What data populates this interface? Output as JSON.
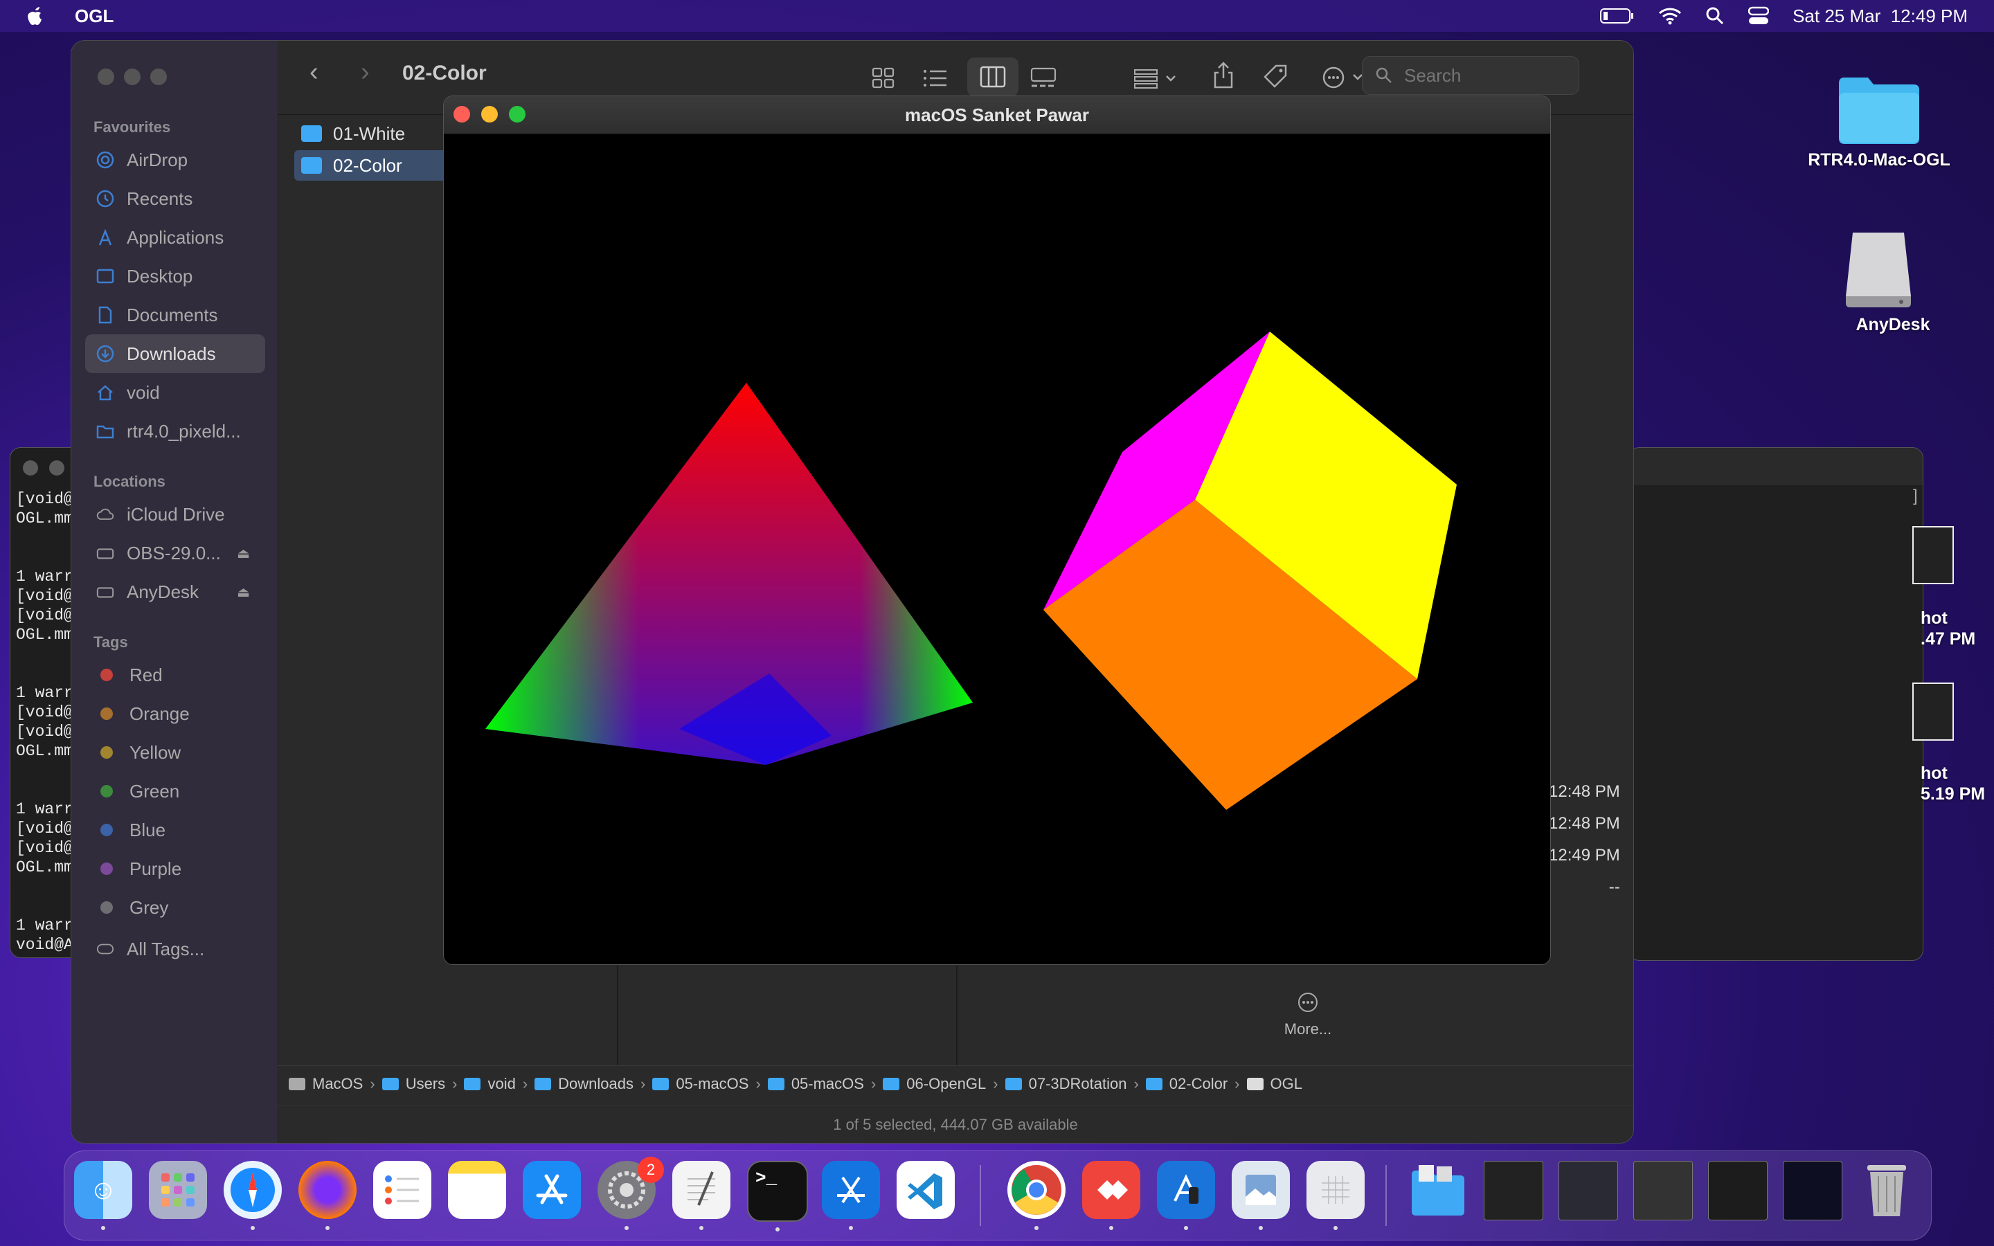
{
  "menubar": {
    "app_name": "OGL",
    "datetime": "Sat 25 Mar  12:49 PM"
  },
  "desktop": {
    "icons": [
      {
        "label": "RTR4.0-Mac-OGL"
      },
      {
        "label": "AnyDesk"
      }
    ]
  },
  "terminal_left": {
    "lines": [
      "[void@A",
      "OGL.mm",
      "",
      "",
      "1 warr",
      "[void@A",
      "[void@A",
      "OGL.mm",
      "",
      "",
      "1 warr",
      "[void@A",
      "[void@A",
      "OGL.mm",
      "",
      "",
      "1 warr",
      "[void@A",
      "[void@A",
      "OGL.mm",
      "",
      "",
      "1 warr",
      "void@A"
    ]
  },
  "right_bg": {
    "times": [
      "12:48 PM",
      "12:48 PM",
      "12:49 PM",
      "--"
    ],
    "shot1": [
      "hot",
      ".47 PM"
    ],
    "shot2": [
      "hot",
      "5.19 PM"
    ]
  },
  "finder": {
    "title": "02-Color",
    "search_placeholder": "Search",
    "sidebar": {
      "favourites_heading": "Favourites",
      "favourites": [
        "AirDrop",
        "Recents",
        "Applications",
        "Desktop",
        "Documents",
        "Downloads",
        "void",
        "rtr4.0_pixeld..."
      ],
      "locations_heading": "Locations",
      "locations": [
        "iCloud Drive",
        "OBS-29.0...",
        "AnyDesk"
      ],
      "tags_heading": "Tags",
      "tags": [
        {
          "label": "Red",
          "color": "#c5413b"
        },
        {
          "label": "Orange",
          "color": "#a66f2d"
        },
        {
          "label": "Yellow",
          "color": "#a0862e"
        },
        {
          "label": "Green",
          "color": "#3b8a3d"
        },
        {
          "label": "Blue",
          "color": "#3c62a8"
        },
        {
          "label": "Purple",
          "color": "#7c4a99"
        },
        {
          "label": "Grey",
          "color": "#6e6e72"
        }
      ],
      "all_tags": "All Tags..."
    },
    "files": [
      "01-White",
      "02-Color"
    ],
    "more_label": "More...",
    "path": [
      "MacOS",
      "Users",
      "void",
      "Downloads",
      "05-macOS",
      "05-macOS",
      "06-OpenGL",
      "07-3DRotation",
      "02-Color",
      "OGL"
    ],
    "status": "1 of 5 selected, 444.07 GB available"
  },
  "gl_window": {
    "title": "macOS Sanket Pawar"
  },
  "dock": {
    "badge": "2",
    "apps": [
      "finder",
      "launchpad",
      "safari",
      "firefox",
      "reminders",
      "notes",
      "app-store",
      "system-preferences",
      "textedit",
      "terminal",
      "xcode",
      "vscode",
      "chrome",
      "anydesk",
      "simulator",
      "preview",
      "grid-app",
      "downloads-stack",
      "window-thumb-1",
      "window-thumb-2",
      "window-thumb-3",
      "window-thumb-4",
      "window-thumb-5",
      "trash"
    ]
  }
}
